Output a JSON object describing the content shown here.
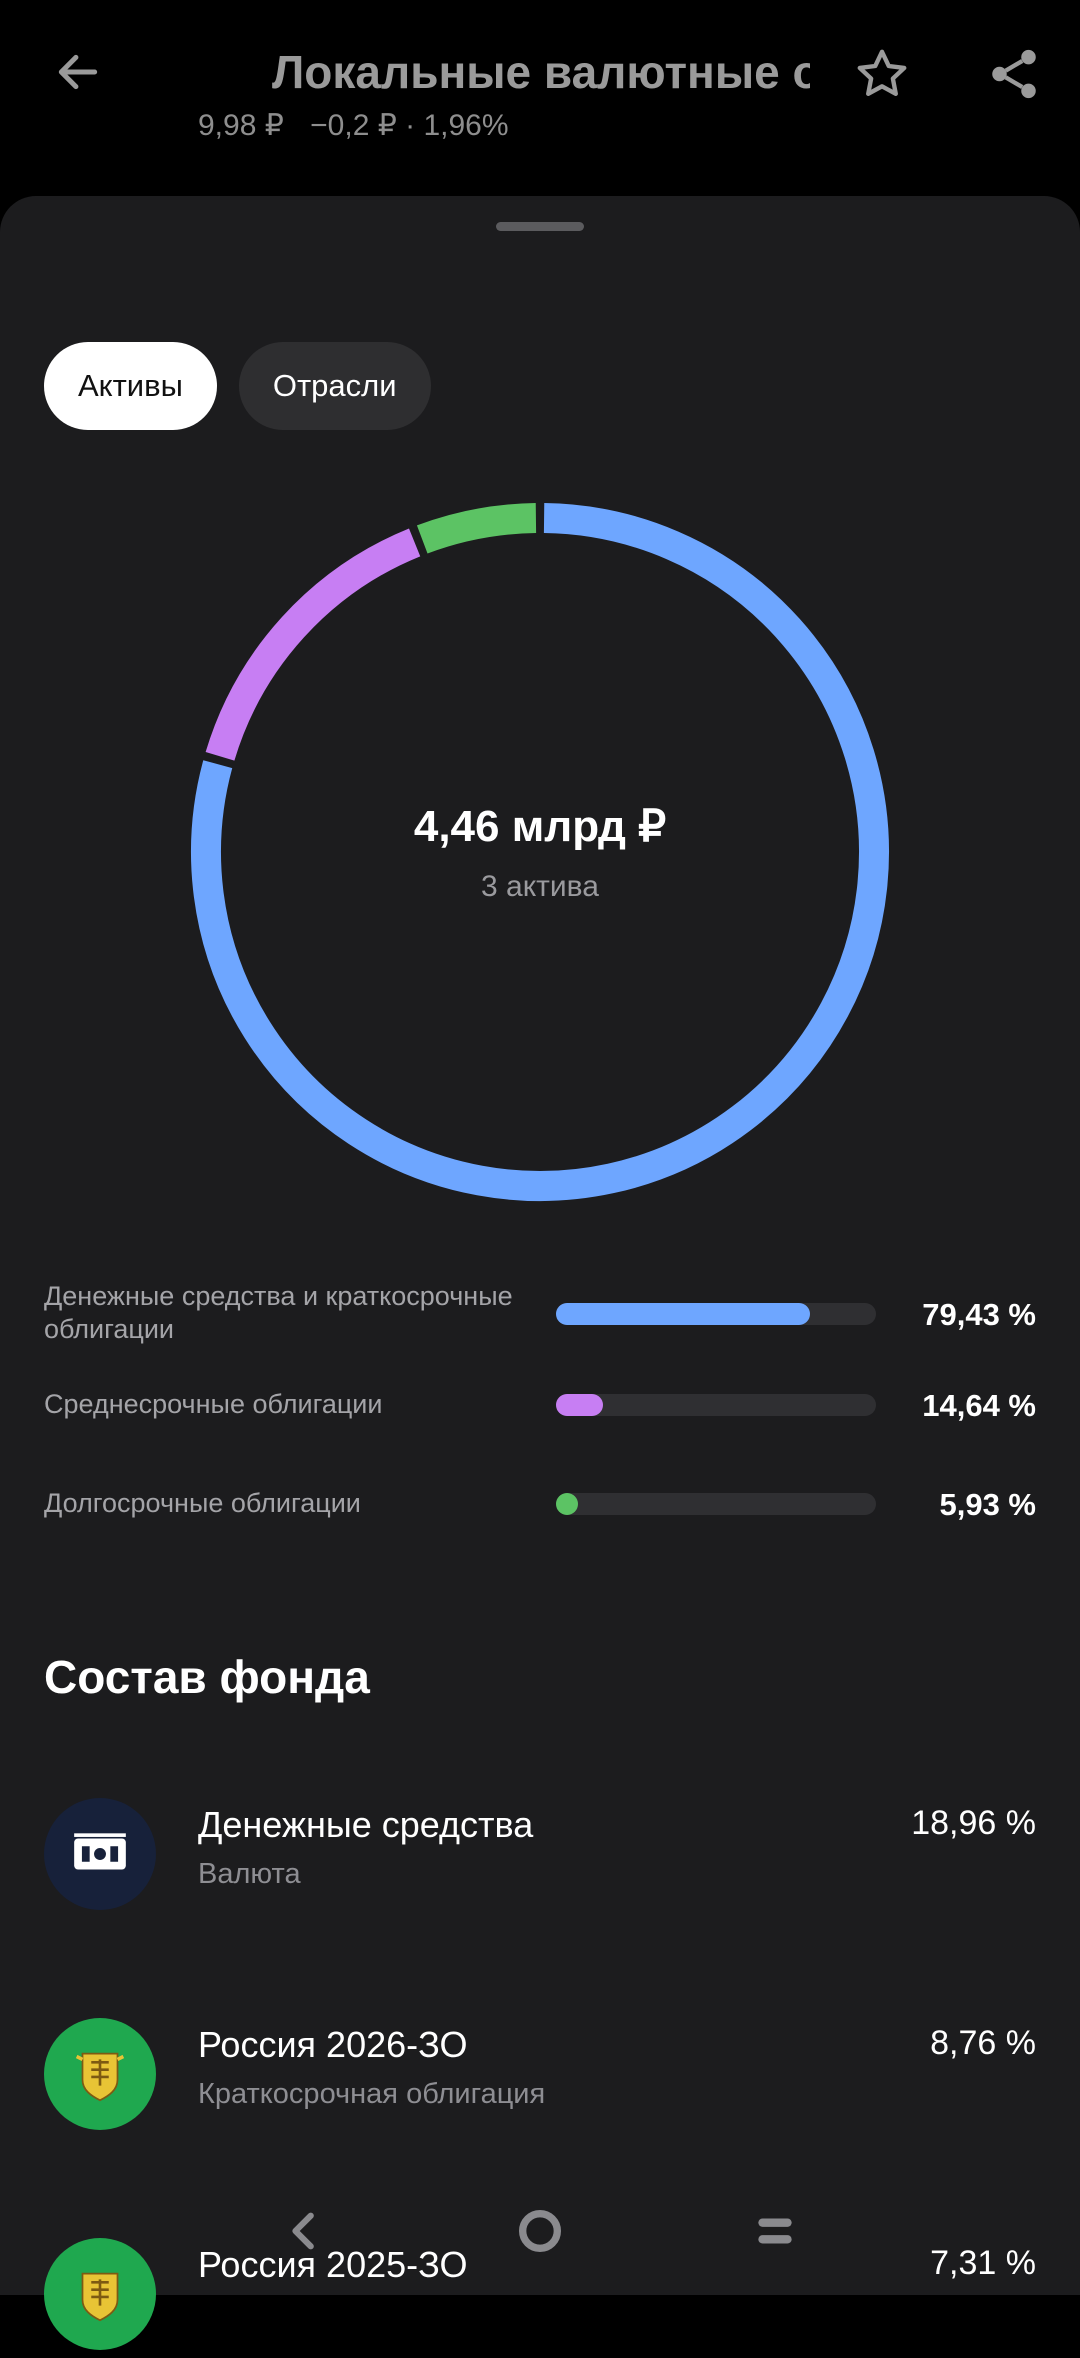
{
  "header": {
    "title": "Локальные валютные облигации",
    "price": "9,98 ₽",
    "change": "−0,2 ₽ · 1,96%"
  },
  "icons": {
    "back": "arrow-left-icon",
    "favorite": "star-outline-icon",
    "share": "share-icon"
  },
  "tabs": [
    {
      "label": "Активы",
      "active": true
    },
    {
      "label": "Отрасли",
      "active": false
    }
  ],
  "chart_data": {
    "type": "pie",
    "categories": [
      "Денежные средства и краткосрочные облигации",
      "Среднесрочные облигации",
      "Долгосрочные облигации"
    ],
    "values": [
      79.43,
      14.64,
      5.93
    ],
    "colors": [
      "#6ea6ff",
      "#c77ef3",
      "#5cc364"
    ],
    "center_value": "4,46 млрд ₽",
    "center_caption": "3 актива"
  },
  "legend": [
    {
      "label": "Денежные средства и краткосрочные облигации",
      "percent": "79,43 %",
      "fraction": 0.7943,
      "color": "#6ea6ff"
    },
    {
      "label": "Среднесрочные облигации",
      "percent": "14,64 %",
      "fraction": 0.1464,
      "color": "#c77ef3"
    },
    {
      "label": "Долгосрочные облигации",
      "percent": "5,93 %",
      "fraction": 0.0593,
      "color": "#5cc364"
    }
  ],
  "composition": {
    "title": "Состав фонда",
    "items": [
      {
        "name": "Денежные средства",
        "type": "Валюта",
        "percent": "18,96 %",
        "icon": "cash-icon"
      },
      {
        "name": "Россия 2026-ЗО",
        "type": "Краткосрочная облигация",
        "percent": "8,76 %",
        "icon": "russia-emblem-icon"
      },
      {
        "name": "Россия 2025-ЗО",
        "type": "",
        "percent": "7,31 %",
        "icon": "russia-emblem-icon"
      }
    ]
  },
  "navbar": {
    "back": "nav-back-icon",
    "home": "nav-home-icon",
    "recents": "nav-recents-icon"
  }
}
